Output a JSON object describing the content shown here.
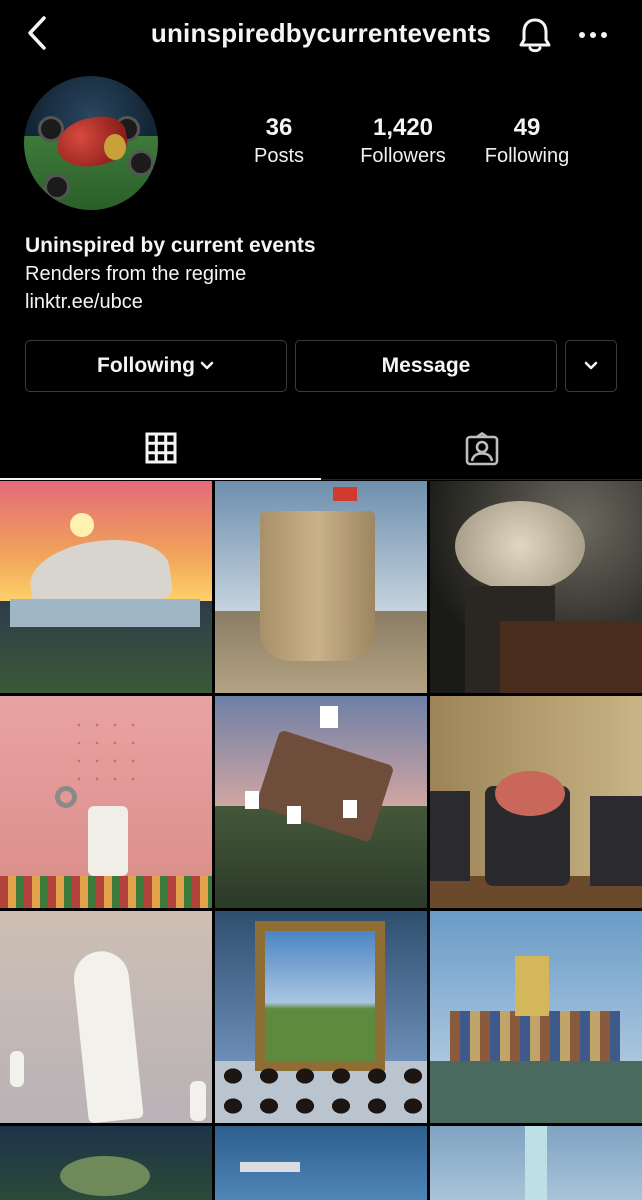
{
  "header": {
    "username": "uninspiredbycurrentevents",
    "back_icon": "chevron-left-icon",
    "notifications_icon": "bell-icon",
    "more_icon": "more-horizontal-icon"
  },
  "profile": {
    "stats": [
      {
        "value": "36",
        "label": "Posts"
      },
      {
        "value": "1,420",
        "label": "Followers"
      },
      {
        "value": "49",
        "label": "Following"
      }
    ],
    "name": "Uninspired by current events",
    "bio": "Renders from the regime",
    "link": "linktr.ee/ubce"
  },
  "actions": {
    "following_label": "Following",
    "message_label": "Message"
  },
  "tabs": [
    {
      "name": "posts-grid",
      "icon": "grid-icon",
      "active": true
    },
    {
      "name": "tagged",
      "icon": "tagged-user-icon",
      "active": false
    }
  ],
  "colors": {
    "background": "#000000",
    "text": "#f5f5f5",
    "border": "#3b3b3b"
  }
}
